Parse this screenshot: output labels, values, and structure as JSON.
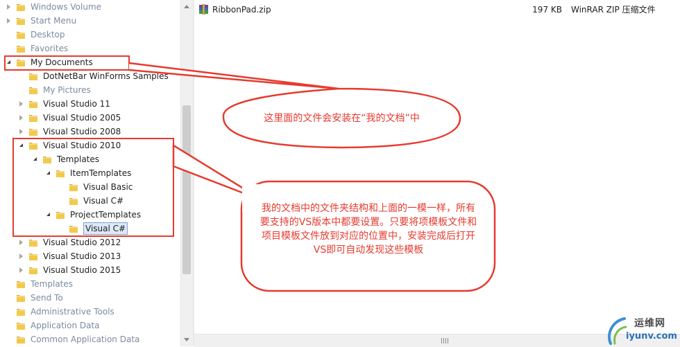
{
  "tree": {
    "items": [
      {
        "label": "Windows Volume",
        "expander": "closed",
        "hidden": true,
        "selected": false
      },
      {
        "label": "Start Menu",
        "expander": "closed",
        "hidden": true,
        "selected": false
      },
      {
        "label": "Desktop",
        "expander": "none",
        "hidden": true,
        "selected": false
      },
      {
        "label": "Favorites",
        "expander": "none",
        "hidden": true,
        "selected": false
      },
      {
        "label": "My Documents",
        "expander": "open",
        "hidden": false,
        "selected": false
      },
      {
        "label": "DotNetBar WinForms Samples",
        "expander": "none",
        "hidden": false,
        "selected": false
      },
      {
        "label": "My Pictures",
        "expander": "none",
        "hidden": true,
        "selected": false
      },
      {
        "label": "Visual Studio 11",
        "expander": "closed",
        "hidden": false,
        "selected": false
      },
      {
        "label": "Visual Studio 2005",
        "expander": "closed",
        "hidden": false,
        "selected": false
      },
      {
        "label": "Visual Studio 2008",
        "expander": "closed",
        "hidden": false,
        "selected": false
      },
      {
        "label": "Visual Studio 2010",
        "expander": "open",
        "hidden": false,
        "selected": false
      },
      {
        "label": "Templates",
        "expander": "open",
        "hidden": false,
        "selected": false
      },
      {
        "label": "ItemTemplates",
        "expander": "open",
        "hidden": false,
        "selected": false
      },
      {
        "label": "Visual Basic",
        "expander": "none",
        "hidden": false,
        "selected": false
      },
      {
        "label": "Visual C#",
        "expander": "none",
        "hidden": false,
        "selected": false
      },
      {
        "label": "ProjectTemplates",
        "expander": "open",
        "hidden": false,
        "selected": false
      },
      {
        "label": "Visual C#",
        "expander": "none",
        "hidden": false,
        "selected": true
      },
      {
        "label": "Visual Studio 2012",
        "expander": "closed",
        "hidden": false,
        "selected": false
      },
      {
        "label": "Visual Studio 2013",
        "expander": "closed",
        "hidden": false,
        "selected": false
      },
      {
        "label": "Visual Studio 2015",
        "expander": "closed",
        "hidden": false,
        "selected": false
      },
      {
        "label": "Templates",
        "expander": "none",
        "hidden": true,
        "selected": false
      },
      {
        "label": "Send To",
        "expander": "none",
        "hidden": true,
        "selected": false
      },
      {
        "label": "Administrative Tools",
        "expander": "none",
        "hidden": true,
        "selected": false
      },
      {
        "label": "Application Data",
        "expander": "none",
        "hidden": true,
        "selected": false
      },
      {
        "label": "Common Application Data",
        "expander": "none",
        "hidden": true,
        "selected": false
      }
    ]
  },
  "files": [
    {
      "name": "RibbonPad.zip",
      "size": "197 KB",
      "type": "WinRAR ZIP 压缩文件",
      "icon": "winrar-archive-icon"
    }
  ],
  "annotations": {
    "callout1": {
      "text": "这里面的文件会安装在“我的文档”中"
    },
    "callout2": {
      "text": "我的文档中的文件夹结构和上面的一模一样，所有要支持的VS版本中都要设置。只要将项模板文件和项目模板文件放到对应的位置中，安装完成后打开VS即可自动发现这些模板"
    }
  },
  "watermark": {
    "title": "运维网",
    "url": "iyunv.com"
  },
  "colors": {
    "annotation_red": "#e63a2e",
    "selection_fill": "#dce9f8",
    "folder_yellow": "#f2c94c",
    "hidden_text": "#7a8ba0"
  }
}
